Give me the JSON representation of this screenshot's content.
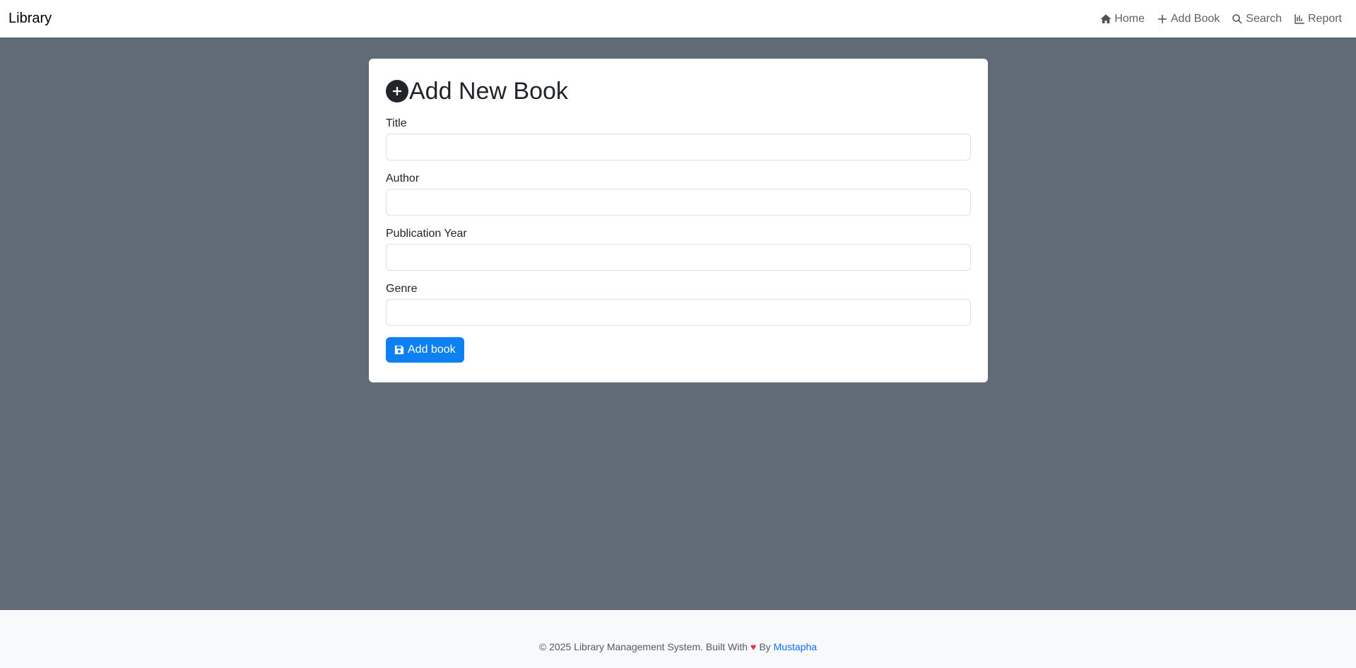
{
  "navbar": {
    "brand": "Library",
    "links": [
      {
        "label": "Home",
        "icon": "home-icon"
      },
      {
        "label": "Add Book",
        "icon": "plus-icon"
      },
      {
        "label": "Search",
        "icon": "search-icon"
      },
      {
        "label": "Report",
        "icon": "chart-icon"
      }
    ]
  },
  "form": {
    "title": "Add New Book",
    "fields": [
      {
        "label": "Title",
        "value": "",
        "placeholder": ""
      },
      {
        "label": "Author",
        "value": "",
        "placeholder": ""
      },
      {
        "label": "Publication Year",
        "value": "",
        "placeholder": ""
      },
      {
        "label": "Genre",
        "value": "",
        "placeholder": ""
      }
    ],
    "submit_label": "Add book"
  },
  "footer": {
    "text_before": "© 2025 Library Management System. Built With",
    "heart": "♥",
    "text_by": "By",
    "author_link": "Mustapha"
  },
  "colors": {
    "background": "#606b76",
    "primary": "#0d80f2",
    "heart": "#dc3545"
  }
}
